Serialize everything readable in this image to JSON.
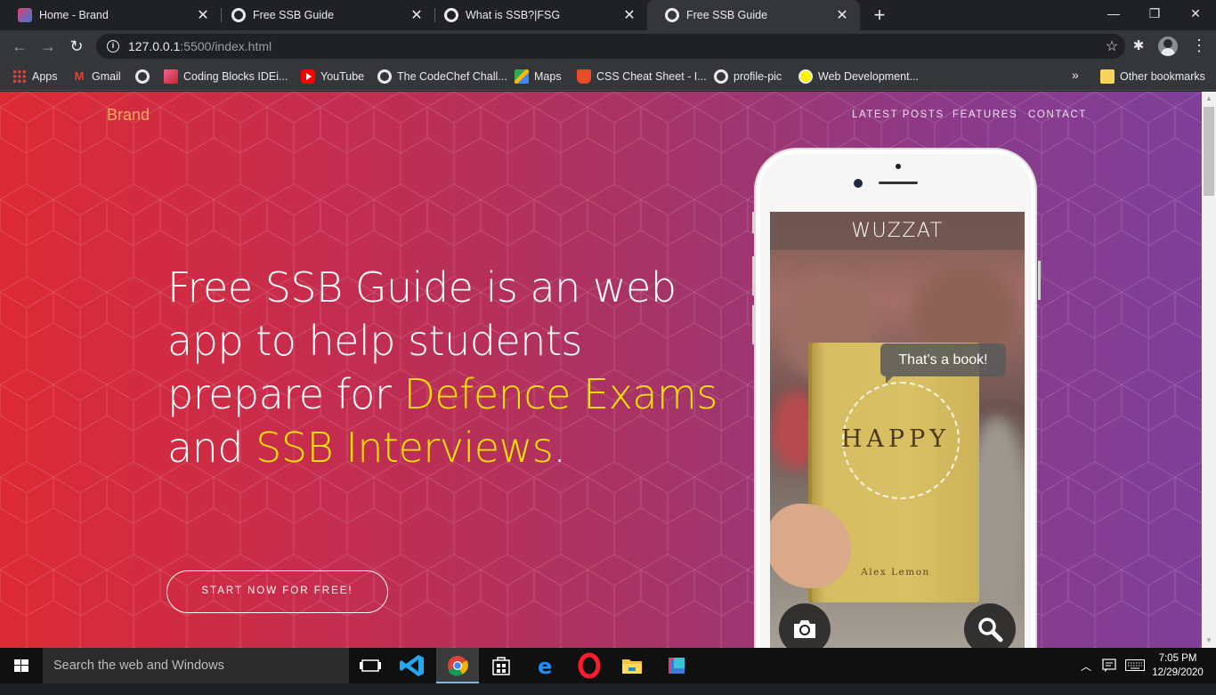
{
  "browser": {
    "tabs": [
      {
        "title": "Home - Brand",
        "active": false
      },
      {
        "title": "Free SSB Guide",
        "active": false
      },
      {
        "title": "What is SSB?|FSG",
        "active": false
      },
      {
        "title": "Free SSB Guide",
        "active": true
      }
    ],
    "url_host": "127.0.0.1",
    "url_path": ":5500/index.html",
    "bookmarks": [
      {
        "label": "Apps",
        "icon": "apps-grid-icon"
      },
      {
        "label": "Gmail",
        "icon": "gmail-icon"
      },
      {
        "label": "",
        "icon": "globe-icon"
      },
      {
        "label": "Coding Blocks IDEi...",
        "icon": "coding-blocks-icon"
      },
      {
        "label": "YouTube",
        "icon": "youtube-icon"
      },
      {
        "label": "The CodeChef Chall...",
        "icon": "globe-icon"
      },
      {
        "label": "Maps",
        "icon": "maps-icon"
      },
      {
        "label": "CSS Cheat Sheet - I...",
        "icon": "css-icon"
      },
      {
        "label": "profile-pic",
        "icon": "globe-icon"
      },
      {
        "label": "Web Development...",
        "icon": "web-dev-icon"
      }
    ],
    "bookmarks_more": "»",
    "other_bookmarks": "Other bookmarks"
  },
  "page": {
    "brand": "Brand",
    "nav": [
      "LATEST POSTS",
      "FEATURES",
      "CONTACT"
    ],
    "headline_parts": {
      "p1": "Free SSB Guide is an web app to help students prepare for ",
      "h1": "Defence Exams",
      "p2": " and ",
      "h2": "SSB Interviews",
      "p3": "."
    },
    "cta": "START NOW FOR FREE!",
    "phone": {
      "app_title": "WUZZAT",
      "tooltip": "That’s a book!",
      "book_title": "HAPPY",
      "book_author": "Alex Lemon"
    },
    "colors": {
      "gradient_start": "#dc2a34",
      "gradient_end": "#7f3f98",
      "highlight": "#ffe600",
      "brand": "#f6a95e"
    }
  },
  "taskbar": {
    "search_placeholder": "Search the web and Windows",
    "time": "7:05 PM",
    "date": "12/29/2020"
  }
}
